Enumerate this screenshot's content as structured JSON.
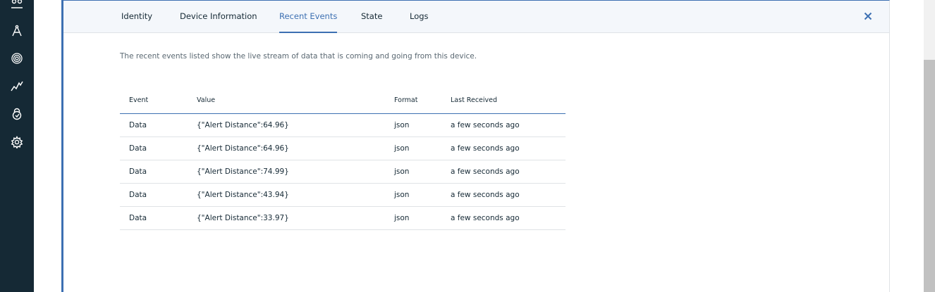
{
  "sidebar": {
    "icons": [
      "users-icon",
      "compass-icon",
      "fingerprint-icon",
      "analytics-icon",
      "lock-icon",
      "gear-icon"
    ]
  },
  "tabs": [
    {
      "label": "Identity",
      "active": false
    },
    {
      "label": "Device Information",
      "active": false
    },
    {
      "label": "Recent Events",
      "active": true
    },
    {
      "label": "State",
      "active": false
    },
    {
      "label": "Logs",
      "active": false
    }
  ],
  "description": "The recent events listed show the live stream of data that is coming and going from this device.",
  "table": {
    "columns": [
      "Event",
      "Value",
      "Format",
      "Last Received"
    ],
    "rows": [
      [
        "Data",
        "{\"Alert Distance\":64.96}",
        "json",
        "a few seconds ago"
      ],
      [
        "Data",
        "{\"Alert Distance\":64.96}",
        "json",
        "a few seconds ago"
      ],
      [
        "Data",
        "{\"Alert Distance\":74.99}",
        "json",
        "a few seconds ago"
      ],
      [
        "Data",
        "{\"Alert Distance\":43.94}",
        "json",
        "a few seconds ago"
      ],
      [
        "Data",
        "{\"Alert Distance\":33.97}",
        "json",
        "a few seconds ago"
      ]
    ]
  },
  "colors": {
    "sidebar": "#152935",
    "accent": "#3d70b2",
    "text": "#152935",
    "muted": "#5a6872"
  }
}
